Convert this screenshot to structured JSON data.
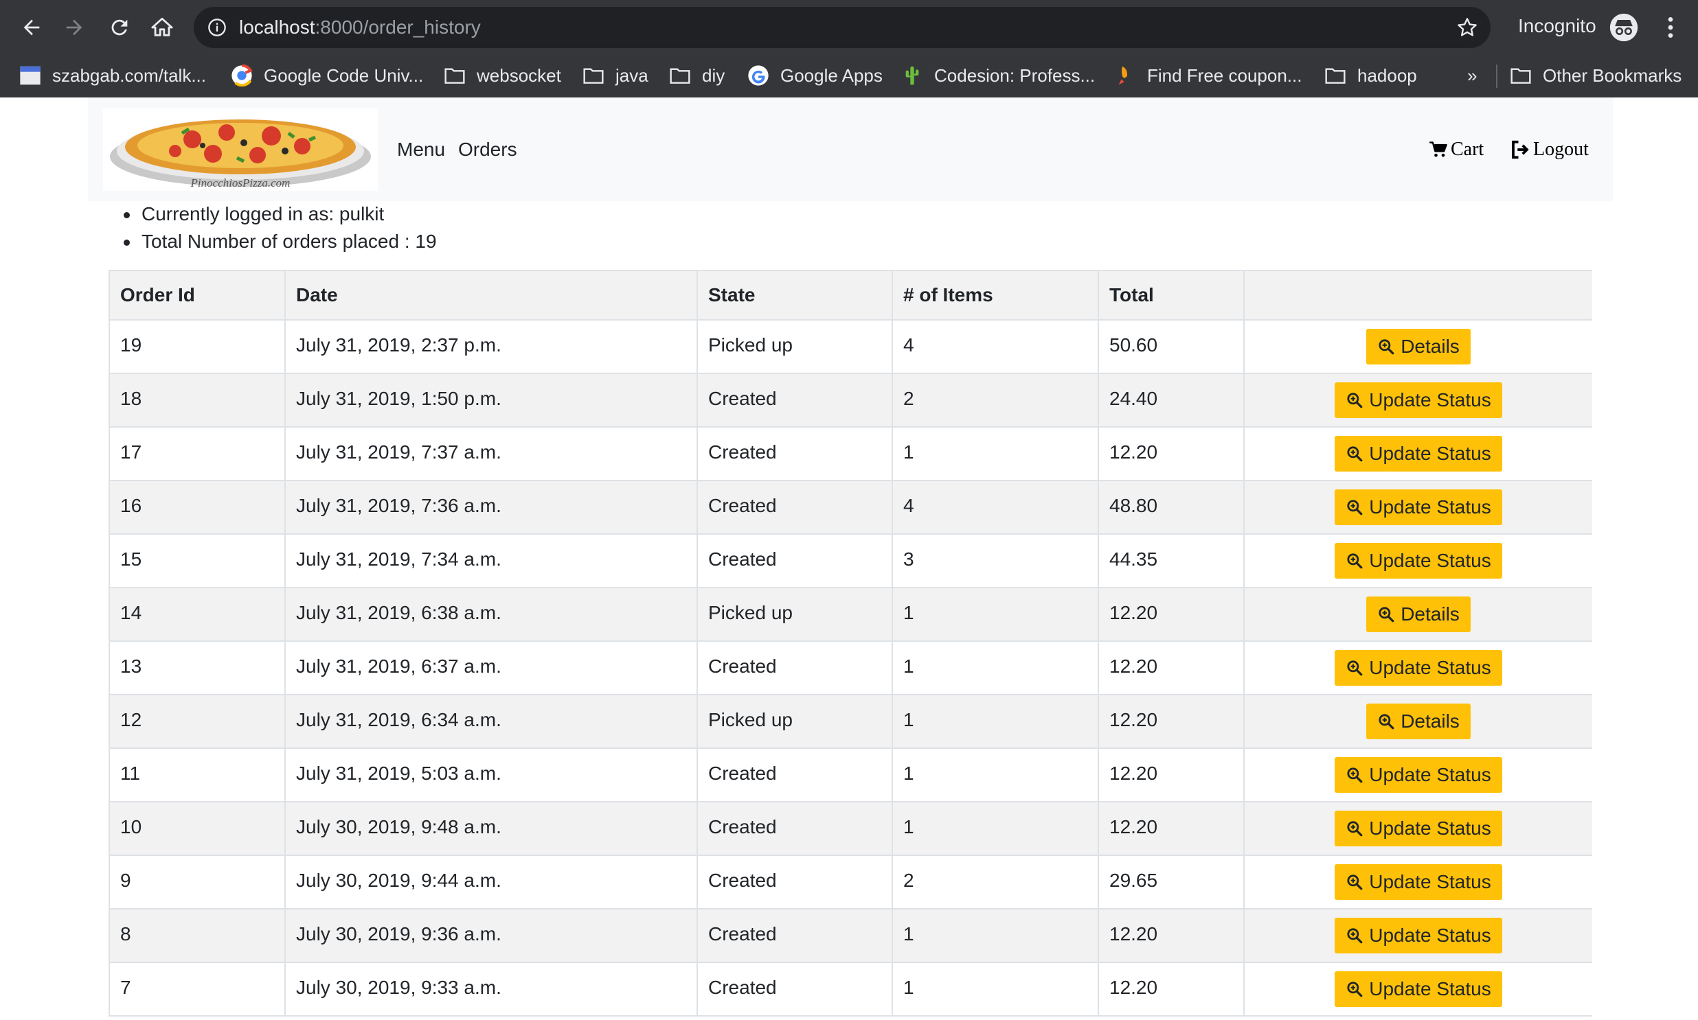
{
  "browser": {
    "url_host": "localhost",
    "url_rest": ":8000/order_history",
    "profile_label": "Incognito",
    "bookmarks": [
      {
        "label": "szabgab.com/talk...",
        "icon": "site-icon"
      },
      {
        "label": "Google Code Univ...",
        "icon": "google-code-icon"
      },
      {
        "label": "websocket",
        "icon": "folder-icon"
      },
      {
        "label": "java",
        "icon": "folder-icon"
      },
      {
        "label": "diy",
        "icon": "folder-icon"
      },
      {
        "label": "Google Apps",
        "icon": "google-icon"
      },
      {
        "label": "Codesion: Profess...",
        "icon": "cactus-icon"
      },
      {
        "label": "Find Free coupon...",
        "icon": "rocket-icon"
      },
      {
        "label": "hadoop",
        "icon": "folder-icon"
      }
    ],
    "overflow_label": "»",
    "other_bookmarks": "Other Bookmarks"
  },
  "nav": {
    "logo_text": "PinocchiosPizza.com",
    "links": [
      "Menu",
      "Orders"
    ],
    "cart_label": "Cart",
    "logout_label": "Logout"
  },
  "info": {
    "logged_in": "Currently logged in as: pulkit",
    "total_orders": "Total Number of orders placed : 19"
  },
  "table": {
    "headers": [
      "Order Id",
      "Date",
      "State",
      "# of Items",
      "Total",
      ""
    ],
    "rows": [
      {
        "id": "19",
        "date": "July 31, 2019, 2:37 p.m.",
        "state": "Picked up",
        "items": "4",
        "total": "50.60",
        "action": "Details"
      },
      {
        "id": "18",
        "date": "July 31, 2019, 1:50 p.m.",
        "state": "Created",
        "items": "2",
        "total": "24.40",
        "action": "Update Status"
      },
      {
        "id": "17",
        "date": "July 31, 2019, 7:37 a.m.",
        "state": "Created",
        "items": "1",
        "total": "12.20",
        "action": "Update Status"
      },
      {
        "id": "16",
        "date": "July 31, 2019, 7:36 a.m.",
        "state": "Created",
        "items": "4",
        "total": "48.80",
        "action": "Update Status"
      },
      {
        "id": "15",
        "date": "July 31, 2019, 7:34 a.m.",
        "state": "Created",
        "items": "3",
        "total": "44.35",
        "action": "Update Status"
      },
      {
        "id": "14",
        "date": "July 31, 2019, 6:38 a.m.",
        "state": "Picked up",
        "items": "1",
        "total": "12.20",
        "action": "Details"
      },
      {
        "id": "13",
        "date": "July 31, 2019, 6:37 a.m.",
        "state": "Created",
        "items": "1",
        "total": "12.20",
        "action": "Update Status"
      },
      {
        "id": "12",
        "date": "July 31, 2019, 6:34 a.m.",
        "state": "Picked up",
        "items": "1",
        "total": "12.20",
        "action": "Details"
      },
      {
        "id": "11",
        "date": "July 31, 2019, 5:03 a.m.",
        "state": "Created",
        "items": "1",
        "total": "12.20",
        "action": "Update Status"
      },
      {
        "id": "10",
        "date": "July 30, 2019, 9:48 a.m.",
        "state": "Created",
        "items": "1",
        "total": "12.20",
        "action": "Update Status"
      },
      {
        "id": "9",
        "date": "July 30, 2019, 9:44 a.m.",
        "state": "Created",
        "items": "2",
        "total": "29.65",
        "action": "Update Status"
      },
      {
        "id": "8",
        "date": "July 30, 2019, 9:36 a.m.",
        "state": "Created",
        "items": "1",
        "total": "12.20",
        "action": "Update Status"
      },
      {
        "id": "7",
        "date": "July 30, 2019, 9:33 a.m.",
        "state": "Created",
        "items": "1",
        "total": "12.20",
        "action": "Update Status"
      }
    ]
  },
  "colors": {
    "chrome_bg": "#35363a",
    "omnibox_bg": "#202124",
    "navbar_bg": "#f8f9fa",
    "button_yellow": "#ffc107",
    "stripe": "#f2f2f2"
  }
}
